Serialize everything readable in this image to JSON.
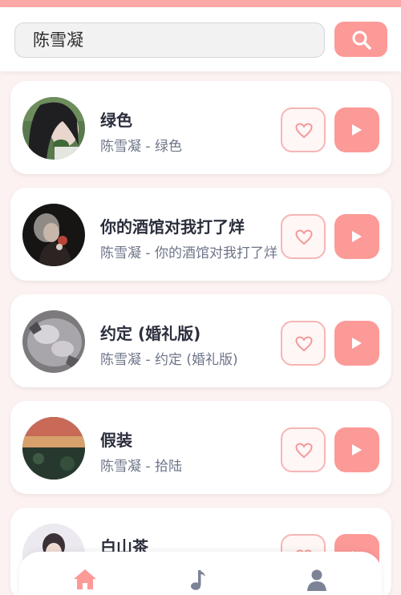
{
  "search": {
    "value": "陈雪凝",
    "button_icon": "search-icon"
  },
  "songs": [
    {
      "title": "绿色",
      "subtitle": "陈雪凝 - 绿色",
      "favorite_icon": "heart-outline-icon",
      "play_icon": "play-icon"
    },
    {
      "title": "你的酒馆对我打了烊",
      "subtitle": "陈雪凝 - 你的酒馆对我打了烊",
      "favorite_icon": "heart-outline-icon",
      "play_icon": "play-icon"
    },
    {
      "title": "约定 (婚礼版)",
      "subtitle": "陈雪凝 - 约定 (婚礼版)",
      "favorite_icon": "heart-outline-icon",
      "play_icon": "play-icon"
    },
    {
      "title": "假装",
      "subtitle": "陈雪凝 - 拾陆",
      "favorite_icon": "heart-outline-icon",
      "play_icon": "play-icon"
    },
    {
      "title": "白山茶",
      "subtitle": "",
      "favorite_icon": "heart-outline-icon",
      "play_icon": "play-icon"
    }
  ],
  "bottom_nav": [
    {
      "icon": "home-icon",
      "active": true
    },
    {
      "icon": "music-note-icon",
      "active": false
    },
    {
      "icon": "user-icon",
      "active": false
    }
  ],
  "colors": {
    "accent": "#fc9a98",
    "accent_border": "#f6b6b5",
    "page_background": "#fdf2f2",
    "nav_inactive": "#7d8396"
  }
}
